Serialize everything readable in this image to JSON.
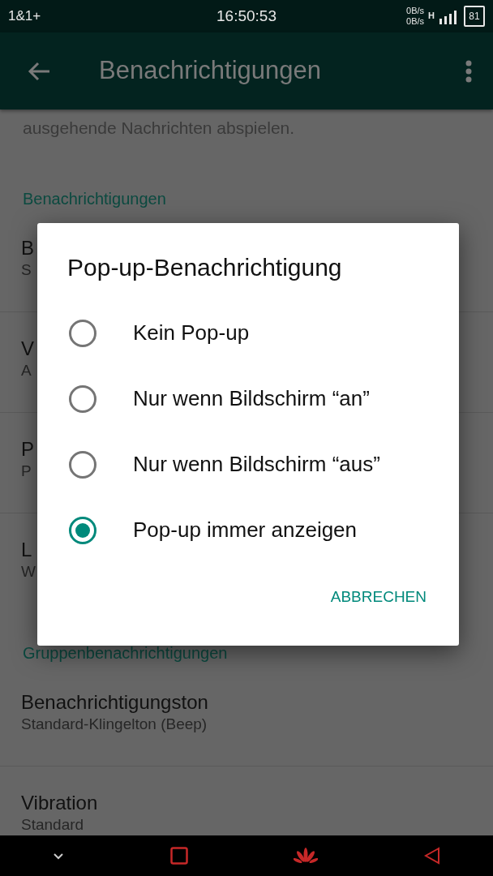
{
  "status_bar": {
    "carrier": "1&1+",
    "time": "16:50:53",
    "upload_speed": "0B/s",
    "download_speed": "0B/s",
    "network_type": "H",
    "battery": "81"
  },
  "app_bar": {
    "title": "Benachrichtigungen"
  },
  "settings": {
    "intro_text": "ausgehende Nachrichten abspielen.",
    "sections": [
      {
        "header": "Benachrichtigungen",
        "items": [
          {
            "title": "B",
            "subtitle": "S"
          },
          {
            "title": "V",
            "subtitle": "A"
          },
          {
            "title": "P",
            "subtitle": "P"
          },
          {
            "title": "L",
            "subtitle": "W"
          }
        ]
      },
      {
        "header": "Gruppenbenachrichtigungen",
        "items": [
          {
            "title": "Benachrichtigungston",
            "subtitle": "Standard-Klingelton (Beep)"
          },
          {
            "title": "Vibration",
            "subtitle": "Standard"
          }
        ]
      }
    ]
  },
  "dialog": {
    "title": "Pop-up-Benachrichtigung",
    "options": [
      {
        "label": "Kein Pop-up",
        "selected": false
      },
      {
        "label": "Nur wenn Bildschirm “an”",
        "selected": false
      },
      {
        "label": "Nur wenn Bildschirm “aus”",
        "selected": false
      },
      {
        "label": "Pop-up immer anzeigen",
        "selected": true
      }
    ],
    "buttons": [
      "ABBRECHEN"
    ]
  }
}
